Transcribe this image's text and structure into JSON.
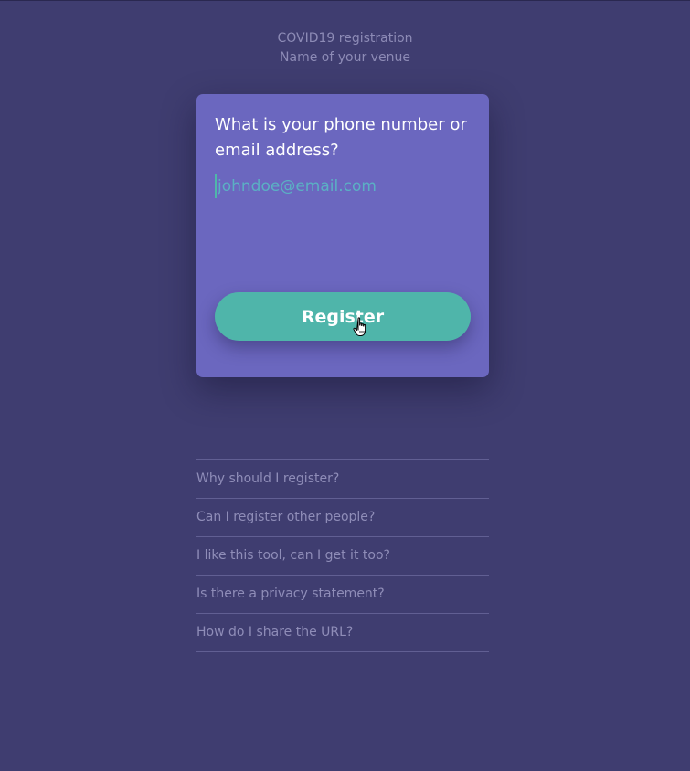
{
  "header": {
    "title": "COVID19 registration",
    "venue": "Name of your venue"
  },
  "card": {
    "question": "What is your phone number or email address?",
    "input": {
      "value": "",
      "placeholder": "johndoe@email.com"
    },
    "register_label": "Register"
  },
  "faq": {
    "items": [
      {
        "label": "Why should I register?"
      },
      {
        "label": "Can I register other people?"
      },
      {
        "label": "I like this tool, can I get it too?"
      },
      {
        "label": "Is there a privacy statement?"
      },
      {
        "label": "How do I share the URL?"
      }
    ]
  },
  "icons": {
    "cursor": "hand-pointer-icon"
  },
  "colors": {
    "background": "#3f3d70",
    "card": "#6b67bf",
    "accent": "#4fb5aa",
    "muted_text": "#8f8db8"
  }
}
